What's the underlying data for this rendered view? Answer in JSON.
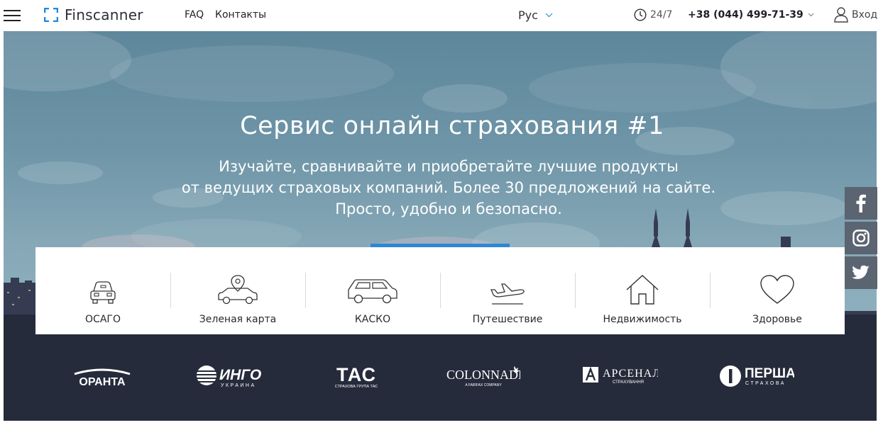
{
  "header": {
    "logo_text": "Finscanner",
    "nav": [
      {
        "label": "FAQ"
      },
      {
        "label": "Контакты"
      }
    ],
    "language": "Рус",
    "support_hours": "24/7",
    "phone": "+38 (044) 499-71-39",
    "login_label": "Вход"
  },
  "hero": {
    "title": "Сервис онлайн страхования #1",
    "subtitle_lines": [
      "Изучайте, сравнивайте и приобретайте лучшие продукты",
      "от ведущих страховых компаний. Более 30 предложений на сайте.",
      "Просто, удобно и безопасно."
    ]
  },
  "categories": [
    {
      "label": "ОСАГО",
      "icon": "car-front-icon"
    },
    {
      "label": "Зеленая карта",
      "icon": "car-location-icon"
    },
    {
      "label": "КАСКО",
      "icon": "car-side-icon"
    },
    {
      "label": "Путешествие",
      "icon": "airplane-icon"
    },
    {
      "label": "Недвижимость",
      "icon": "house-icon"
    },
    {
      "label": "Здоровье",
      "icon": "heart-icon"
    }
  ],
  "partners": [
    {
      "name": "ОРАНТА"
    },
    {
      "name": "ИНГО",
      "tagline": "УКРАИНА"
    },
    {
      "name": "ТАС",
      "tagline": "СТРАХОВА ГРУПА ТАС"
    },
    {
      "name": "COLONNADE",
      "tagline": "A FAIRFAX COMPANY"
    },
    {
      "name": "АРСЕНАЛ",
      "tagline": "СТРАХУВАННЯ"
    },
    {
      "name": "ПЕРША",
      "tagline": "СТРАХОВА"
    }
  ],
  "social": [
    {
      "icon": "facebook-icon"
    },
    {
      "icon": "instagram-icon"
    },
    {
      "icon": "twitter-icon"
    }
  ],
  "colors": {
    "accent": "#2f86d4",
    "logo_blue": "#1e88e5",
    "dark_band": "#262b3b",
    "social_bg": "#5b6471"
  }
}
